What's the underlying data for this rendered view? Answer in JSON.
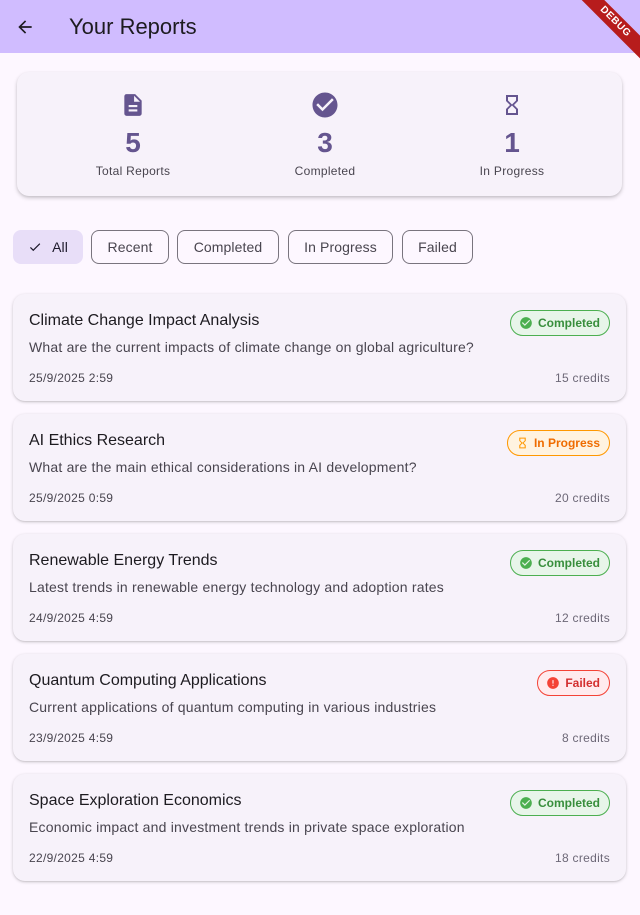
{
  "appbar": {
    "title": "Your Reports",
    "debug_label": "DEBUG"
  },
  "summary": {
    "total": {
      "value": "5",
      "label": "Total Reports"
    },
    "completed": {
      "value": "3",
      "label": "Completed"
    },
    "in_progress": {
      "value": "1",
      "label": "In Progress"
    }
  },
  "filters": [
    {
      "label": "All",
      "selected": true
    },
    {
      "label": "Recent",
      "selected": false
    },
    {
      "label": "Completed",
      "selected": false
    },
    {
      "label": "In Progress",
      "selected": false
    },
    {
      "label": "Failed",
      "selected": false
    }
  ],
  "reports": [
    {
      "title": "Climate Change Impact Analysis",
      "description": "What are the current impacts of climate change on global agriculture?",
      "date": "25/9/2025 2:59",
      "credits": "15 credits",
      "status": "Completed"
    },
    {
      "title": "AI Ethics Research",
      "description": "What are the main ethical considerations in AI development?",
      "date": "25/9/2025 0:59",
      "credits": "20 credits",
      "status": "In Progress"
    },
    {
      "title": "Renewable Energy Trends",
      "description": "Latest trends in renewable energy technology and adoption rates",
      "date": "24/9/2025 4:59",
      "credits": "12 credits",
      "status": "Completed"
    },
    {
      "title": "Quantum Computing Applications",
      "description": "Current applications of quantum computing in various industries",
      "date": "23/9/2025 4:59",
      "credits": "8 credits",
      "status": "Failed"
    },
    {
      "title": "Space Exploration Economics",
      "description": "Economic impact and investment trends in private space exploration",
      "date": "22/9/2025 4:59",
      "credits": "18 credits",
      "status": "Completed"
    }
  ],
  "colors": {
    "appbar": "#d0bcff",
    "accent": "#65558f",
    "completed": "#4caf50",
    "in_progress": "#ff9800",
    "failed": "#f44336"
  }
}
